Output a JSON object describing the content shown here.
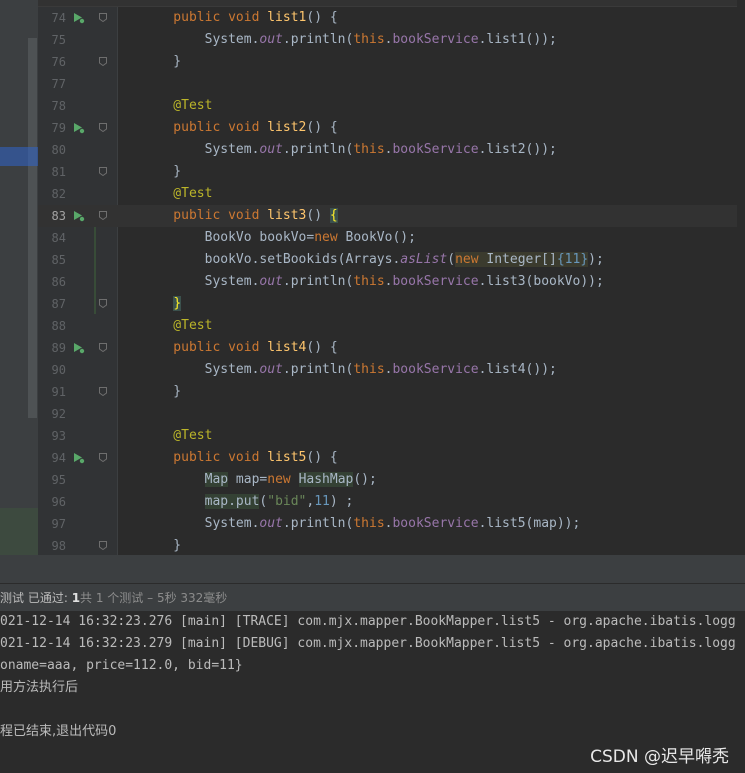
{
  "editor": {
    "lines": [
      {
        "no": "74",
        "run": true,
        "fold": true,
        "tokens": [
          [
            "kw",
            "    public void "
          ],
          [
            "fn",
            "list1"
          ],
          [
            "",
            "() {"
          ]
        ]
      },
      {
        "no": "75",
        "run": false,
        "fold": false,
        "tokens": [
          [
            "",
            "        System."
          ],
          [
            "sfld",
            "out"
          ],
          [
            "",
            ".println("
          ],
          [
            "kw",
            "this"
          ],
          [
            "",
            "."
          ],
          [
            "fld",
            "bookService"
          ],
          [
            "",
            ".list1());"
          ]
        ]
      },
      {
        "no": "76",
        "run": false,
        "fold": true,
        "tokens": [
          [
            "",
            "    }"
          ]
        ]
      },
      {
        "no": "77",
        "run": false,
        "fold": false,
        "tokens": []
      },
      {
        "no": "78",
        "run": false,
        "fold": false,
        "tokens": [
          [
            "ann",
            "    @Test"
          ]
        ]
      },
      {
        "no": "79",
        "run": true,
        "fold": true,
        "tokens": [
          [
            "kw",
            "    public void "
          ],
          [
            "fn",
            "list2"
          ],
          [
            "",
            "() {"
          ]
        ]
      },
      {
        "no": "80",
        "run": false,
        "fold": false,
        "tokens": [
          [
            "",
            "        System."
          ],
          [
            "sfld",
            "out"
          ],
          [
            "",
            ".println("
          ],
          [
            "kw",
            "this"
          ],
          [
            "",
            "."
          ],
          [
            "fld",
            "bookService"
          ],
          [
            "",
            ".list2());"
          ]
        ]
      },
      {
        "no": "81",
        "run": false,
        "fold": true,
        "tokens": [
          [
            "",
            "    }"
          ]
        ]
      },
      {
        "no": "82",
        "run": false,
        "fold": false,
        "tokens": [
          [
            "ann",
            "    @Test"
          ]
        ]
      },
      {
        "no": "83",
        "run": true,
        "fold": true,
        "current": true,
        "tokens": [
          [
            "kw",
            "    public void "
          ],
          [
            "fn",
            "list3"
          ],
          [
            "",
            "() "
          ],
          [
            "brace-match",
            "{"
          ]
        ]
      },
      {
        "no": "84",
        "run": false,
        "fold": false,
        "tokens": [
          [
            "",
            "        BookVo bookVo="
          ],
          [
            "kw",
            "new "
          ],
          [
            "",
            "BookVo();"
          ]
        ]
      },
      {
        "no": "85",
        "run": false,
        "fold": false,
        "tokens": [
          [
            "",
            "        bookVo.setBookids(Arrays."
          ],
          [
            "sfld",
            "asList"
          ],
          [
            "",
            "("
          ],
          [
            "hl kw",
            "new "
          ],
          [
            "hl",
            "Integer[]"
          ],
          [
            "hl num",
            "{11}"
          ],
          [
            "",
            ");"
          ]
        ]
      },
      {
        "no": "86",
        "run": false,
        "fold": false,
        "tokens": [
          [
            "",
            "        System."
          ],
          [
            "sfld",
            "out"
          ],
          [
            "",
            ".println("
          ],
          [
            "kw",
            "this"
          ],
          [
            "",
            "."
          ],
          [
            "fld",
            "bookService"
          ],
          [
            "",
            ".list3(bookVo));"
          ]
        ]
      },
      {
        "no": "87",
        "run": false,
        "fold": true,
        "tokens": [
          [
            "",
            "    "
          ],
          [
            "brace-match",
            "}"
          ]
        ]
      },
      {
        "no": "88",
        "run": false,
        "fold": false,
        "tokens": [
          [
            "ann",
            "    @Test"
          ]
        ]
      },
      {
        "no": "89",
        "run": true,
        "fold": true,
        "tokens": [
          [
            "kw",
            "    public void "
          ],
          [
            "fn",
            "list4"
          ],
          [
            "",
            "() {"
          ]
        ]
      },
      {
        "no": "90",
        "run": false,
        "fold": false,
        "tokens": [
          [
            "",
            "        System."
          ],
          [
            "sfld",
            "out"
          ],
          [
            "",
            ".println("
          ],
          [
            "kw",
            "this"
          ],
          [
            "",
            "."
          ],
          [
            "fld",
            "bookService"
          ],
          [
            "",
            ".list4());"
          ]
        ]
      },
      {
        "no": "91",
        "run": false,
        "fold": true,
        "tokens": [
          [
            "",
            "    }"
          ]
        ]
      },
      {
        "no": "92",
        "run": false,
        "fold": false,
        "tokens": []
      },
      {
        "no": "93",
        "run": false,
        "fold": false,
        "tokens": [
          [
            "ann",
            "    @Test"
          ]
        ]
      },
      {
        "no": "94",
        "run": true,
        "fold": true,
        "tokens": [
          [
            "kw",
            "    public void "
          ],
          [
            "fn",
            "list5"
          ],
          [
            "",
            "() {"
          ]
        ]
      },
      {
        "no": "95",
        "run": false,
        "fold": false,
        "tokens": [
          [
            "",
            "        "
          ],
          [
            "hl2",
            "Map"
          ],
          [
            "",
            " map="
          ],
          [
            "kw",
            "new "
          ],
          [
            "hl2",
            "HashMap"
          ],
          [
            "",
            "();"
          ]
        ]
      },
      {
        "no": "96",
        "run": false,
        "fold": false,
        "tokens": [
          [
            "",
            "        "
          ],
          [
            "hl2",
            "map.put"
          ],
          [
            "",
            "("
          ],
          [
            "str",
            "\"bid\""
          ],
          [
            "",
            ","
          ],
          [
            "num",
            "11"
          ],
          [
            "",
            ") ;"
          ]
        ]
      },
      {
        "no": "97",
        "run": false,
        "fold": false,
        "tokens": [
          [
            "",
            "        System."
          ],
          [
            "sfld",
            "out"
          ],
          [
            "",
            ".println("
          ],
          [
            "kw",
            "this"
          ],
          [
            "",
            "."
          ],
          [
            "fld",
            "bookService"
          ],
          [
            "",
            ".list5(map));"
          ]
        ]
      },
      {
        "no": "98",
        "run": false,
        "fold": true,
        "tokens": [
          [
            "",
            "    }"
          ]
        ]
      }
    ]
  },
  "status_bar": {
    "prefix": "测试 已通过: ",
    "passed": "1",
    "suffix": "共 1 个测试 – 5秒 332毫秒"
  },
  "console": {
    "lines": [
      "021-12-14 16:32:23.276 [main] [TRACE] com.mjx.mapper.BookMapper.list5 - org.apache.ibatis.logg",
      "021-12-14 16:32:23.279 [main] [DEBUG] com.mjx.mapper.BookMapper.list5 - org.apache.ibatis.logg",
      "oname=aaa, price=112.0, bid=11}",
      "用方法执行后",
      "",
      "程已结束,退出代码0"
    ]
  },
  "watermark": "CSDN @迟早嘚秃",
  "colors": {
    "background": "#2b2b2b",
    "keyword": "#cc7832",
    "method": "#ffc66d",
    "annotation": "#bbb529",
    "field": "#9876aa",
    "run_icon": "#59a869"
  },
  "icons": {
    "run": "run-test-icon",
    "fold": "fold-marker-icon"
  }
}
